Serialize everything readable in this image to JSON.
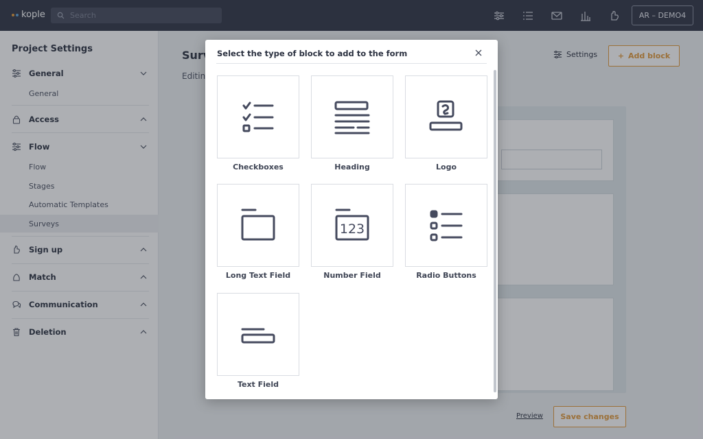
{
  "topbar": {
    "logo_text": "kople",
    "search_placeholder": "Search",
    "user_label": "AR – DEMO4"
  },
  "sidebar": {
    "title": "Project Settings",
    "sections": [
      {
        "label": "General",
        "icon": "sliders-icon",
        "expanded": true,
        "items": [
          "General"
        ]
      },
      {
        "label": "Access",
        "icon": "lock-icon",
        "expanded": false,
        "items": []
      },
      {
        "label": "Flow",
        "icon": "sliders-icon",
        "expanded": true,
        "items": [
          "Flow",
          "Stages",
          "Automatic Templates",
          "Surveys"
        ]
      },
      {
        "label": "Sign up",
        "icon": "hand-icon",
        "expanded": false,
        "items": []
      },
      {
        "label": "Match",
        "icon": "match-icon",
        "expanded": false,
        "items": []
      },
      {
        "label": "Communication",
        "icon": "chat-icon",
        "expanded": false,
        "items": []
      },
      {
        "label": "Deletion",
        "icon": "trash-icon",
        "expanded": false,
        "items": []
      }
    ],
    "active_item": "Surveys"
  },
  "main": {
    "title": "Surv",
    "subtitle": "Editin",
    "settings_label": "Settings",
    "add_block_label": "Add block",
    "preview_label": "Preview",
    "save_label": "Save changes"
  },
  "modal": {
    "title": "Select the type of block to add to the form",
    "blocks": [
      {
        "label": "Checkboxes",
        "icon": "checkboxes-icon"
      },
      {
        "label": "Heading",
        "icon": "heading-icon"
      },
      {
        "label": "Logo",
        "icon": "logo-icon"
      },
      {
        "label": "Long Text Field",
        "icon": "long-text-field-icon"
      },
      {
        "label": "Number Field",
        "icon": "number-field-icon",
        "glyph": "123"
      },
      {
        "label": "Radio Buttons",
        "icon": "radio-buttons-icon"
      },
      {
        "label": "Text Field",
        "icon": "text-field-icon"
      }
    ]
  },
  "colors": {
    "topbar": "#2f3445",
    "accent": "#e39a3a",
    "icon": "#454a5e"
  }
}
